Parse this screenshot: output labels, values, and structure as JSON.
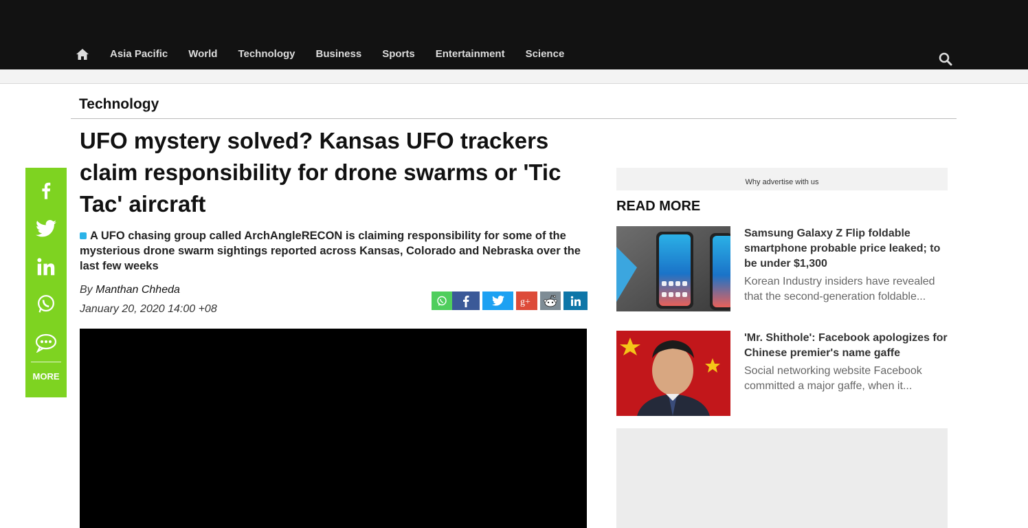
{
  "nav": {
    "home_icon": "home-icon",
    "items": [
      "Asia Pacific",
      "World",
      "Technology",
      "Business",
      "Sports",
      "Entertainment",
      "Science"
    ],
    "search_icon": "search-icon"
  },
  "article": {
    "section": "Technology",
    "headline": "UFO mystery solved? Kansas UFO trackers claim responsibility for drone swarms or 'Tic Tac' aircraft",
    "summary": "A UFO chasing group called ArchAngleRECON is claiming responsibility for some of the mysterious drone swarm sightings reported across Kansas, Colorado and Nebraska over the last few weeks",
    "by_prefix": "By",
    "author": "Manthan Chheda",
    "date": "January 20, 2020 14:00 +08"
  },
  "share_bar": {
    "icons": [
      "whatsapp-icon",
      "facebook-icon",
      "twitter-icon",
      "google-plus-icon",
      "reddit-icon",
      "linkedin-icon"
    ],
    "colors": {
      "whatsapp": "#4fce5d",
      "facebook": "#3b5998",
      "twitter": "#1da1f2",
      "googleplus": "#dd4b39",
      "reddit": "#7e8c95",
      "linkedin": "#0e76a8"
    }
  },
  "sidebar": {
    "icons": [
      "facebook-icon",
      "twitter-icon",
      "linkedin-icon",
      "whatsapp-icon",
      "comment-icon"
    ],
    "more_label": "MORE",
    "color": "#7ed321"
  },
  "ad": {
    "why_advertise": "Why advertise with us"
  },
  "read_more": {
    "title": "READ MORE",
    "items": [
      {
        "title": "Samsung Galaxy Z Flip foldable smartphone probable price leaked; to be under $1,300",
        "desc": "Korean Industry insiders have revealed that the second-generation foldable..."
      },
      {
        "title": "'Mr. Shithole': Facebook apologizes for Chinese premier's name gaffe",
        "desc": "Social networking website Facebook committed a major gaffe, when it..."
      }
    ]
  }
}
